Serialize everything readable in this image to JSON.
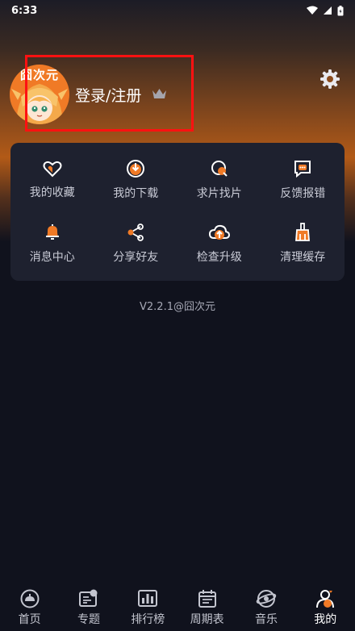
{
  "status_bar": {
    "time": "6:33"
  },
  "profile": {
    "avatar_text": "囧次元",
    "login_label": "登录/注册"
  },
  "grid": {
    "items": [
      {
        "label": "我的收藏",
        "icon": "heart-icon"
      },
      {
        "label": "我的下载",
        "icon": "download-icon"
      },
      {
        "label": "求片找片",
        "icon": "search-film-icon"
      },
      {
        "label": "反馈报错",
        "icon": "feedback-icon"
      },
      {
        "label": "消息中心",
        "icon": "bell-icon"
      },
      {
        "label": "分享好友",
        "icon": "share-icon"
      },
      {
        "label": "检查升级",
        "icon": "cloud-upgrade-icon"
      },
      {
        "label": "清理缓存",
        "icon": "broom-icon"
      }
    ]
  },
  "version_text": "V2.2.1@囧次元",
  "tabs": [
    {
      "label": "首页",
      "icon": "home-icon",
      "active": false
    },
    {
      "label": "专题",
      "icon": "topic-icon",
      "active": false
    },
    {
      "label": "排行榜",
      "icon": "ranking-icon",
      "active": false
    },
    {
      "label": "周期表",
      "icon": "calendar-icon",
      "active": false
    },
    {
      "label": "音乐",
      "icon": "music-icon",
      "active": false
    },
    {
      "label": "我的",
      "icon": "profile-icon",
      "active": true
    }
  ],
  "colors": {
    "accent": "#f07a26",
    "background": "#10121d",
    "card": "#1e212f",
    "highlight": "#ff1111"
  }
}
